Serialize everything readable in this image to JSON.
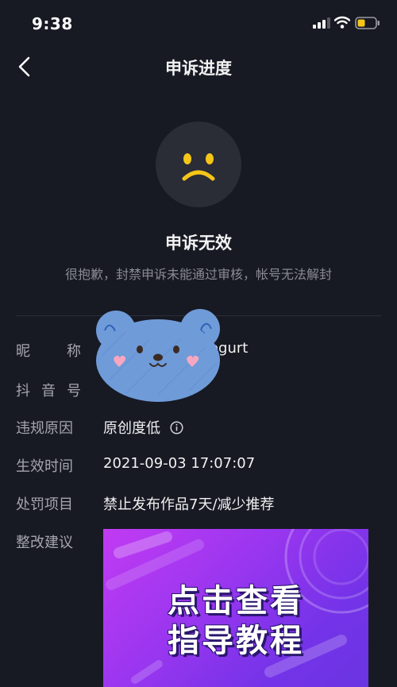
{
  "status_bar": {
    "time": "9:38"
  },
  "nav": {
    "title": "申诉进度"
  },
  "result": {
    "title": "申诉无效",
    "description": "很抱歉，封禁申诉未能通过审核，帐号无法解封"
  },
  "fields": {
    "nickname": {
      "label_chars": [
        "昵",
        "称"
      ],
      "value_suffix": "ogurt"
    },
    "douyin_id": {
      "label_chars": [
        "抖",
        "音",
        "号"
      ]
    },
    "violation_reason": {
      "label": "违规原因",
      "value": "原创度低"
    },
    "effective_time": {
      "label": "生效时间",
      "value": "2021-09-03 17:07:07"
    },
    "penalty": {
      "label": "处罚项目",
      "value": "禁止发布作品7天/减少推荐"
    },
    "suggestion": {
      "label": "整改建议"
    }
  },
  "guide_banner": {
    "line1": "点击查看",
    "line2": "指导教程"
  },
  "icons": {
    "back": "chevron-left-icon",
    "signal": "signal-icon",
    "wifi": "wifi-icon",
    "battery": "battery-icon",
    "sad_face": "sad-face-icon",
    "info": "info-icon",
    "sticker": "bear-sticker"
  },
  "colors": {
    "background": "#171923",
    "battery_level": "#f5c518",
    "face_accent": "#f5c518",
    "banner": "#9b36f0"
  }
}
